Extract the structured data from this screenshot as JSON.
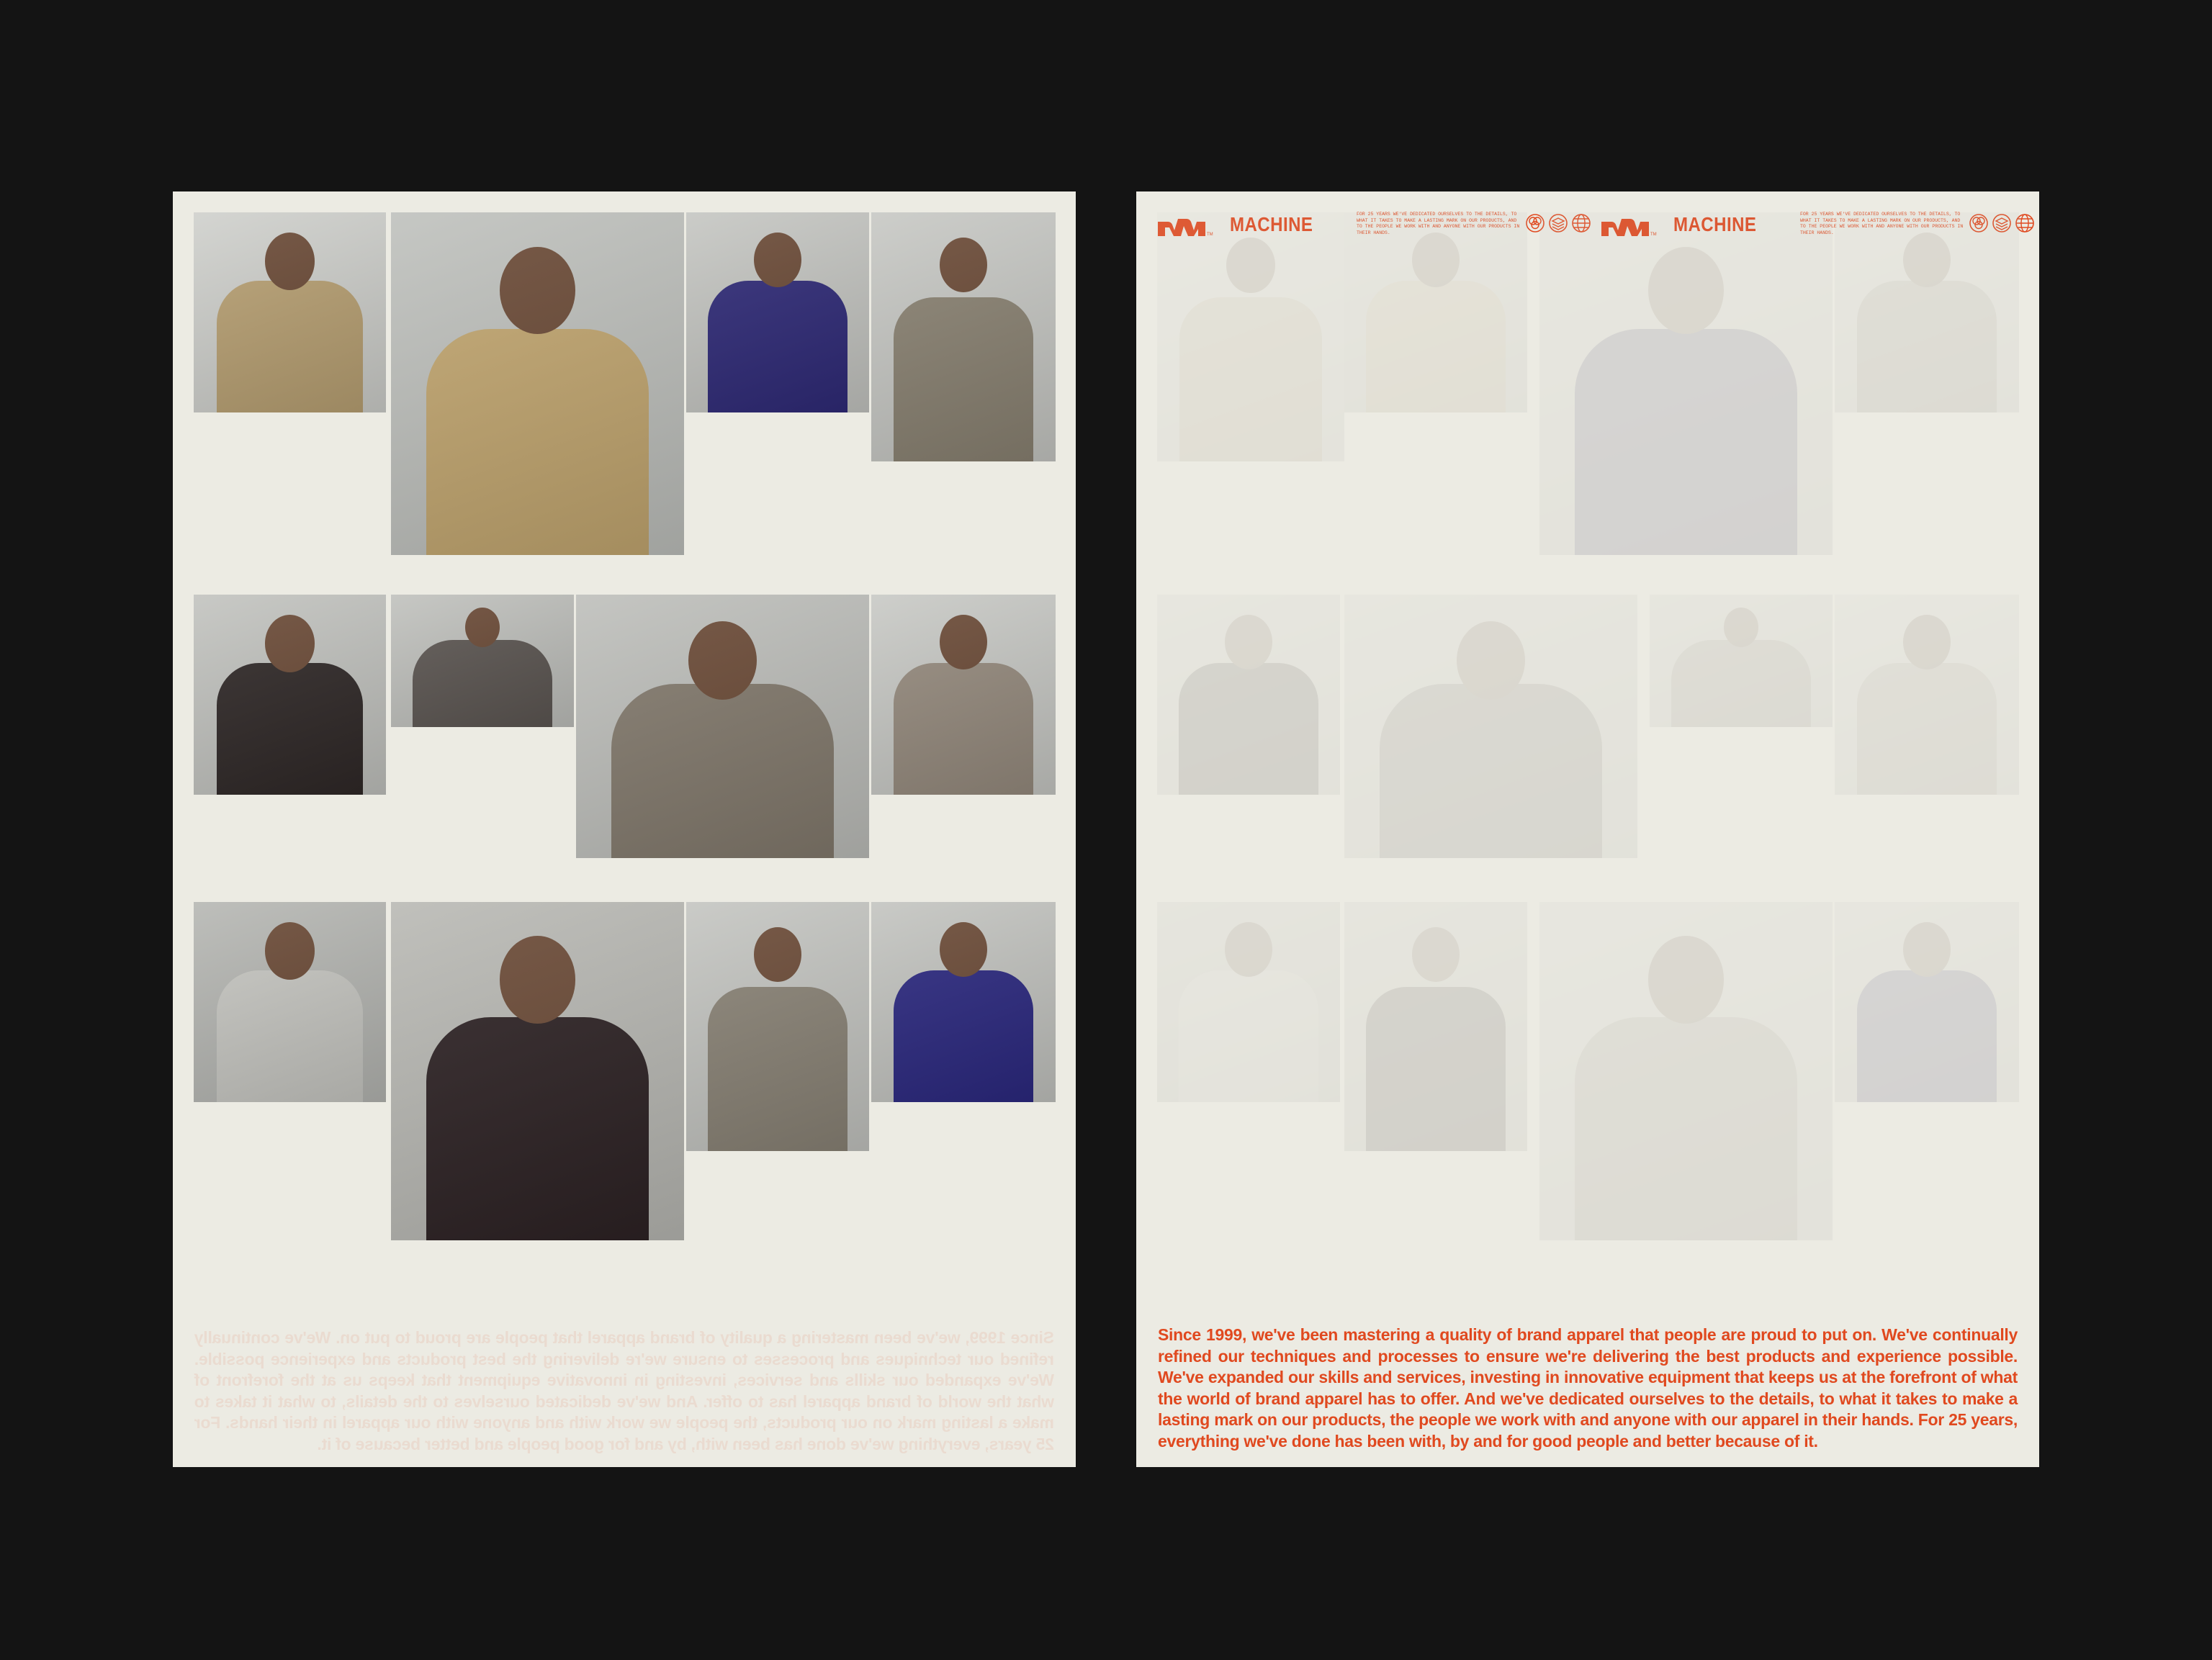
{
  "colors": {
    "background": "#141414",
    "paper": "#ecebe3",
    "accent": "#e0491f"
  },
  "brand": {
    "name": "MACHINE",
    "logo_icon": "machine-logo-icon",
    "tagline": "FOR 25 YEARS WE'VE DEDICATED OURSELVES TO THE DETAILS, TO WHAT IT TAKES TO MAKE A LASTING MARK ON OUR PRODUCTS, AND TO THE PEOPLE WE WORK WITH AND ANYONE WITH OUR PRODUCTS IN THEIR HANDS.",
    "icons": [
      "venn-circles-icon",
      "layers-icon",
      "globe-icon"
    ]
  },
  "left_poster": {
    "photos": [
      {
        "name": "photo-tan-sweatshirt-arms-crossed",
        "garment": "#b9a173",
        "bg": "#cfd0cc"
      },
      {
        "name": "photo-tan-shoulder-closeup",
        "garment": "#c3a770",
        "bg": "#bfc1bd"
      },
      {
        "name": "photo-navy-hoodie-up",
        "garment": "#2f2a78",
        "bg": "#c5c6c2"
      },
      {
        "name": "photo-taupe-open-jacket",
        "garment": "#8a8272",
        "bg": "#c7c8c4"
      },
      {
        "name": "photo-black-hoodie-back",
        "garment": "#2f2827",
        "bg": "#c2c3bf"
      },
      {
        "name": "photo-grey-hoodie-back",
        "garment": "#5c5652",
        "bg": "#c0c1bd"
      },
      {
        "name": "photo-taupe-hoodie-hands-on-head",
        "garment": "#837a6d",
        "bg": "#bebfbb"
      },
      {
        "name": "photo-taupe-hood-profile",
        "garment": "#968b7e",
        "bg": "#c8c9c5"
      },
      {
        "name": "photo-light-grey-hoodie",
        "garment": "#c8c8c3",
        "bg": "#b6b7b3"
      },
      {
        "name": "photo-black-hoodie-portrait",
        "garment": "#2d2224",
        "bg": "#b9b9b4"
      },
      {
        "name": "photo-taupe-crew-hands-on-hips",
        "garment": "#8a8376",
        "bg": "#c4c5c1"
      },
      {
        "name": "photo-navy-crew",
        "garment": "#2b2880",
        "bg": "#c3c4c0"
      }
    ],
    "bleed_text": "Since 1999, we've been mastering a quality of brand apparel that people are proud to put on. We've continually refined our techniques and processes to ensure we're delivering the best products and experience possible. We've expanded our skills and services, investing in innovative equipment that keeps us at the forefront of what the world of brand apparel has to offer. And we've dedicated ourselves to the details, to what it takes to make a lasting mark on our products, the people we work with and anyone with our apparel in their hands. For 25 years, everything we've done has been with, by and for good people and better because of it."
  },
  "right_poster": {
    "body": "Since 1999, we've been mastering a quality of brand apparel that people are proud to put on. We've continually refined our techniques and processes to ensure we're delivering the best products and experience possible. We've expanded our skills and services, investing in innovative equipment that keeps us at the forefront of what the world of brand apparel has to offer. And we've dedicated ourselves to the details, to what it takes to make a lasting mark on our products, the people we work with and anyone with our apparel in their hands. For 25 years, everything we've done has been with, by and for good people and better because of it."
  }
}
